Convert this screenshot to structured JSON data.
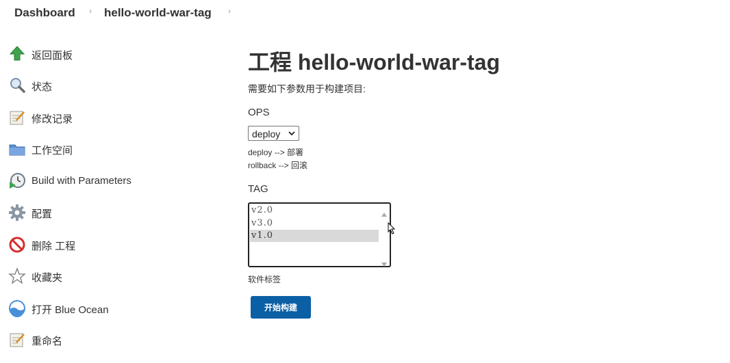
{
  "breadcrumb": {
    "items": [
      {
        "label": "Dashboard"
      },
      {
        "label": "hello-world-war-tag"
      }
    ],
    "separator": "›"
  },
  "sidebar": {
    "items": [
      {
        "label": "返回面板",
        "icon": "up-arrow-icon"
      },
      {
        "label": "状态",
        "icon": "magnifier-icon"
      },
      {
        "label": "修改记录",
        "icon": "notepad-icon"
      },
      {
        "label": "工作空间",
        "icon": "folder-icon"
      },
      {
        "label": "Build with Parameters",
        "icon": "clock-play-icon"
      },
      {
        "label": "配置",
        "icon": "gear-icon"
      },
      {
        "label": "删除 工程",
        "icon": "no-entry-icon"
      },
      {
        "label": "收藏夹",
        "icon": "star-icon"
      },
      {
        "label": "打开 Blue Ocean",
        "icon": "blue-ocean-icon"
      },
      {
        "label": "重命名",
        "icon": "notepad-icon"
      }
    ]
  },
  "main": {
    "title": "工程 hello-world-war-tag",
    "intro": "需要如下参数用于构建项目:",
    "params": {
      "ops": {
        "name": "OPS",
        "selected": "deploy",
        "descriptions": [
          "deploy --> 部署",
          "rollback --> 回滚"
        ]
      },
      "tag": {
        "name": "TAG",
        "options": [
          "v2.0",
          "v3.0",
          "v1.0"
        ],
        "selected": "v1.0",
        "description": "软件标签"
      }
    },
    "build_button": "开始构建"
  },
  "colors": {
    "button_bg": "#0b5fa5",
    "selected_option_bg": "#d9d9d9"
  }
}
